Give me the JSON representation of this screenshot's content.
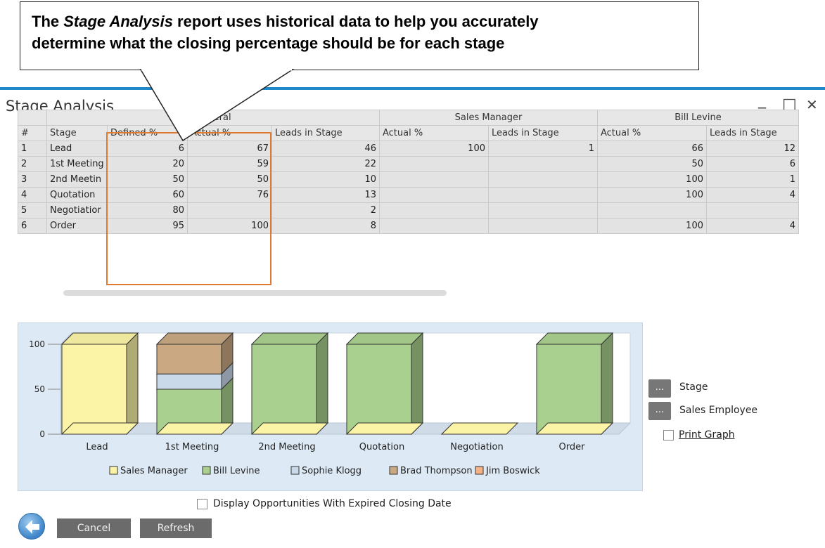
{
  "callout": {
    "line1_pre": "The ",
    "line1_italic": "Stage Analysis",
    "line1_post": " report uses historical data to help you accurately",
    "line2": "determine what the closing percentage should be for each stage"
  },
  "window": {
    "title": "Stage Analysis",
    "minimize_glyph": "_",
    "maximize_glyph": "□",
    "close_glyph": "✕"
  },
  "table": {
    "groups": [
      "General",
      "Sales Manager",
      "Bill Levine"
    ],
    "columns": [
      "#",
      "Stage",
      "Defined %",
      "Actual %",
      "Leads in Stage",
      "Actual %",
      "Leads in Stage",
      "Actual %",
      "Leads in Stage"
    ],
    "rows": [
      [
        "1",
        "Lead",
        "6",
        "67",
        "46",
        "100",
        "1",
        "66",
        "12"
      ],
      [
        "2",
        "1st Meeting",
        "20",
        "59",
        "22",
        "",
        "",
        "50",
        "6"
      ],
      [
        "3",
        "2nd Meetin",
        "50",
        "50",
        "10",
        "",
        "",
        "100",
        "1"
      ],
      [
        "4",
        "Quotation",
        "60",
        "76",
        "13",
        "",
        "",
        "100",
        "4"
      ],
      [
        "5",
        "Negotiatior",
        "80",
        "",
        "2",
        "",
        "",
        "",
        ""
      ],
      [
        "6",
        "Order",
        "95",
        "100",
        "8",
        "",
        "",
        "100",
        "4"
      ]
    ]
  },
  "chart_data": {
    "type": "bar",
    "categories": [
      "Lead",
      "1st Meeting",
      "2nd Meeting",
      "Quotation",
      "Negotiation",
      "Order"
    ],
    "ylim": [
      0,
      100
    ],
    "yticks": [
      "0",
      "50",
      "100"
    ],
    "stacked": true,
    "series": [
      {
        "name": "Sales Manager",
        "color": "#fbf3a6",
        "values": [
          100,
          0,
          0,
          0,
          0,
          0
        ]
      },
      {
        "name": "Bill Levine",
        "color": "#a9d08e",
        "values": [
          0,
          50,
          100,
          100,
          0,
          100
        ]
      },
      {
        "name": "Sophie Klogg",
        "color": "#c9d9ea",
        "values": [
          0,
          17,
          0,
          0,
          0,
          0
        ]
      },
      {
        "name": "Brad Thompson",
        "color": "#c9a882",
        "values": [
          0,
          33,
          0,
          0,
          0,
          0
        ]
      },
      {
        "name": "Jim Boswick",
        "color": "#f4b184",
        "values": [
          0,
          0,
          0,
          0,
          0,
          0
        ]
      }
    ]
  },
  "side": {
    "stage_btn": "...",
    "stage_label": "Stage",
    "employee_btn": "...",
    "employee_label": "Sales Employee",
    "print_graph_label": "Print Graph"
  },
  "footer": {
    "expired_label": "Display Opportunities With Expired Closing Date",
    "cancel_label": "Cancel",
    "refresh_label": "Refresh"
  }
}
